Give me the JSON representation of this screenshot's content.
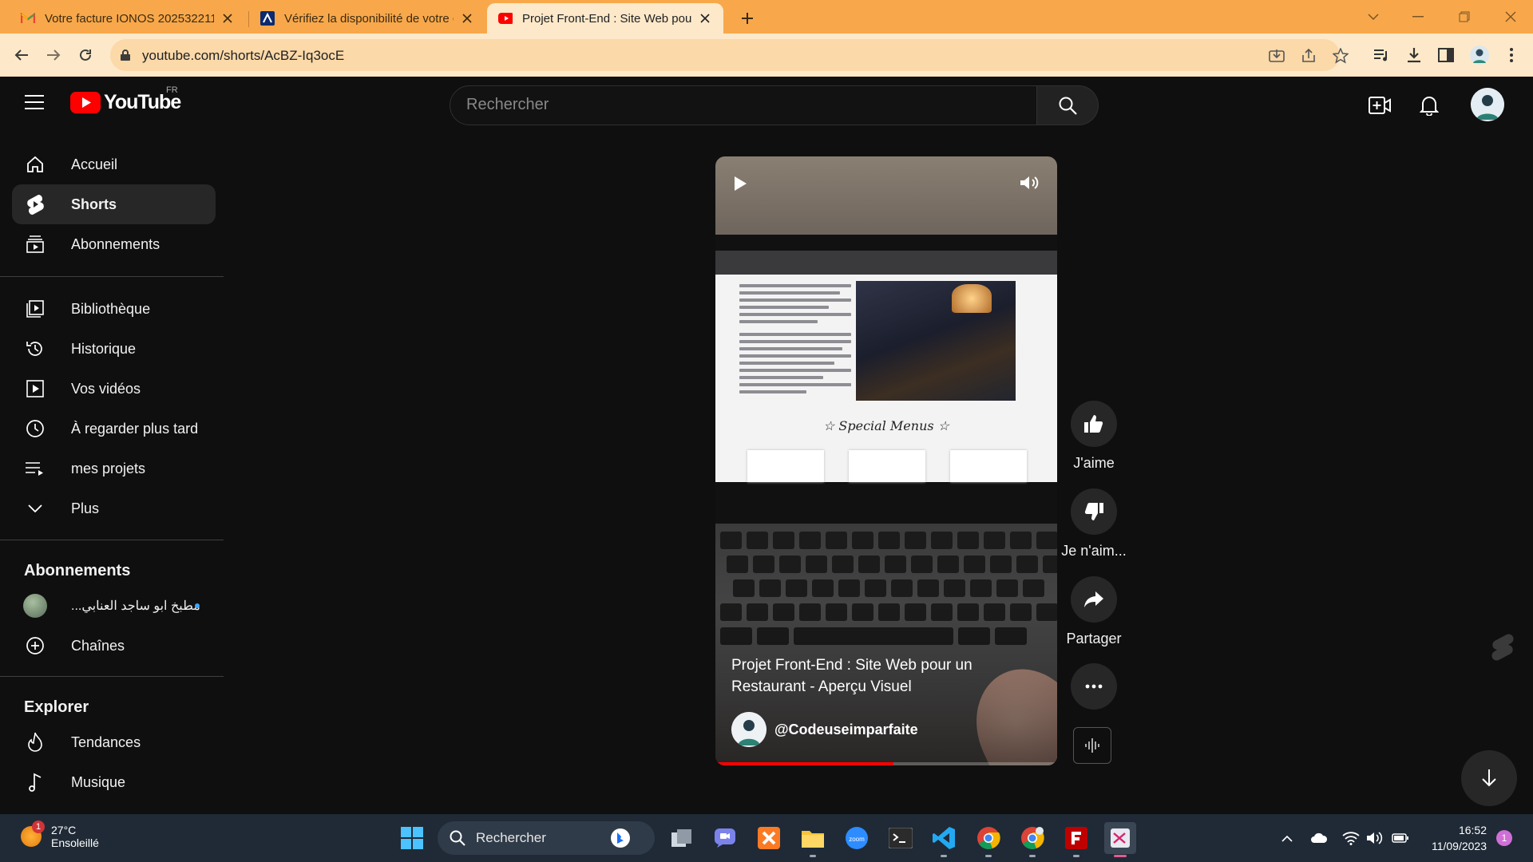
{
  "browser": {
    "tabs": [
      {
        "title": "Votre facture IONOS 202532211",
        "icon": "gmail-icon"
      },
      {
        "title": "Vérifiez la disponibilité de votre d",
        "icon": "ionos-icon"
      },
      {
        "title": "Projet Front-End : Site Web pour",
        "icon": "youtube-icon"
      }
    ],
    "url": "youtube.com/shorts/AcBZ-Iq3ocE"
  },
  "youtube": {
    "logo_text": "YouTube",
    "country_code": "FR",
    "search_placeholder": "Rechercher",
    "sidebar": {
      "main": [
        {
          "label": "Accueil",
          "icon": "home-icon"
        },
        {
          "label": "Shorts",
          "icon": "shorts-icon"
        },
        {
          "label": "Abonnements",
          "icon": "subscriptions-icon"
        }
      ],
      "library": [
        {
          "label": "Bibliothèque",
          "icon": "library-icon"
        },
        {
          "label": "Historique",
          "icon": "history-icon"
        },
        {
          "label": "Vos vidéos",
          "icon": "your-videos-icon"
        },
        {
          "label": "À regarder plus tard",
          "icon": "watch-later-icon"
        },
        {
          "label": "mes projets",
          "icon": "playlist-icon"
        },
        {
          "label": "Plus",
          "icon": "chevron-down-icon"
        }
      ],
      "subscriptions_heading": "Abonnements",
      "subscriptions": [
        {
          "label": "...مطبخ ابو ساجد العنابي"
        },
        {
          "label": "Chaînes"
        }
      ],
      "explore_heading": "Explorer",
      "explore": [
        {
          "label": "Tendances",
          "icon": "trending-icon"
        },
        {
          "label": "Musique",
          "icon": "music-icon"
        }
      ]
    },
    "short": {
      "title": "Projet Front-End : Site Web pour un Restaurant - Aperçu Visuel",
      "channel": "@Codeuseimparfaite",
      "screen_heading": "☆ Special Menus ☆",
      "progress": 0.52
    },
    "actions": {
      "like": "J'aime",
      "dislike": "Je n'aim...",
      "share": "Partager"
    }
  },
  "taskbar": {
    "weather_temp": "27°C",
    "weather_desc": "Ensoleillé",
    "weather_badge": "1",
    "search": "Rechercher",
    "time": "16:52",
    "date": "11/09/2023",
    "notifications": "1"
  },
  "colors": {
    "chrome_frame": "#f8a84a",
    "chrome_toolbar": "#fde9c9",
    "yt_bg": "#0f0f0f",
    "yt_red": "#ff0000",
    "taskbar": "#1f2a36"
  }
}
